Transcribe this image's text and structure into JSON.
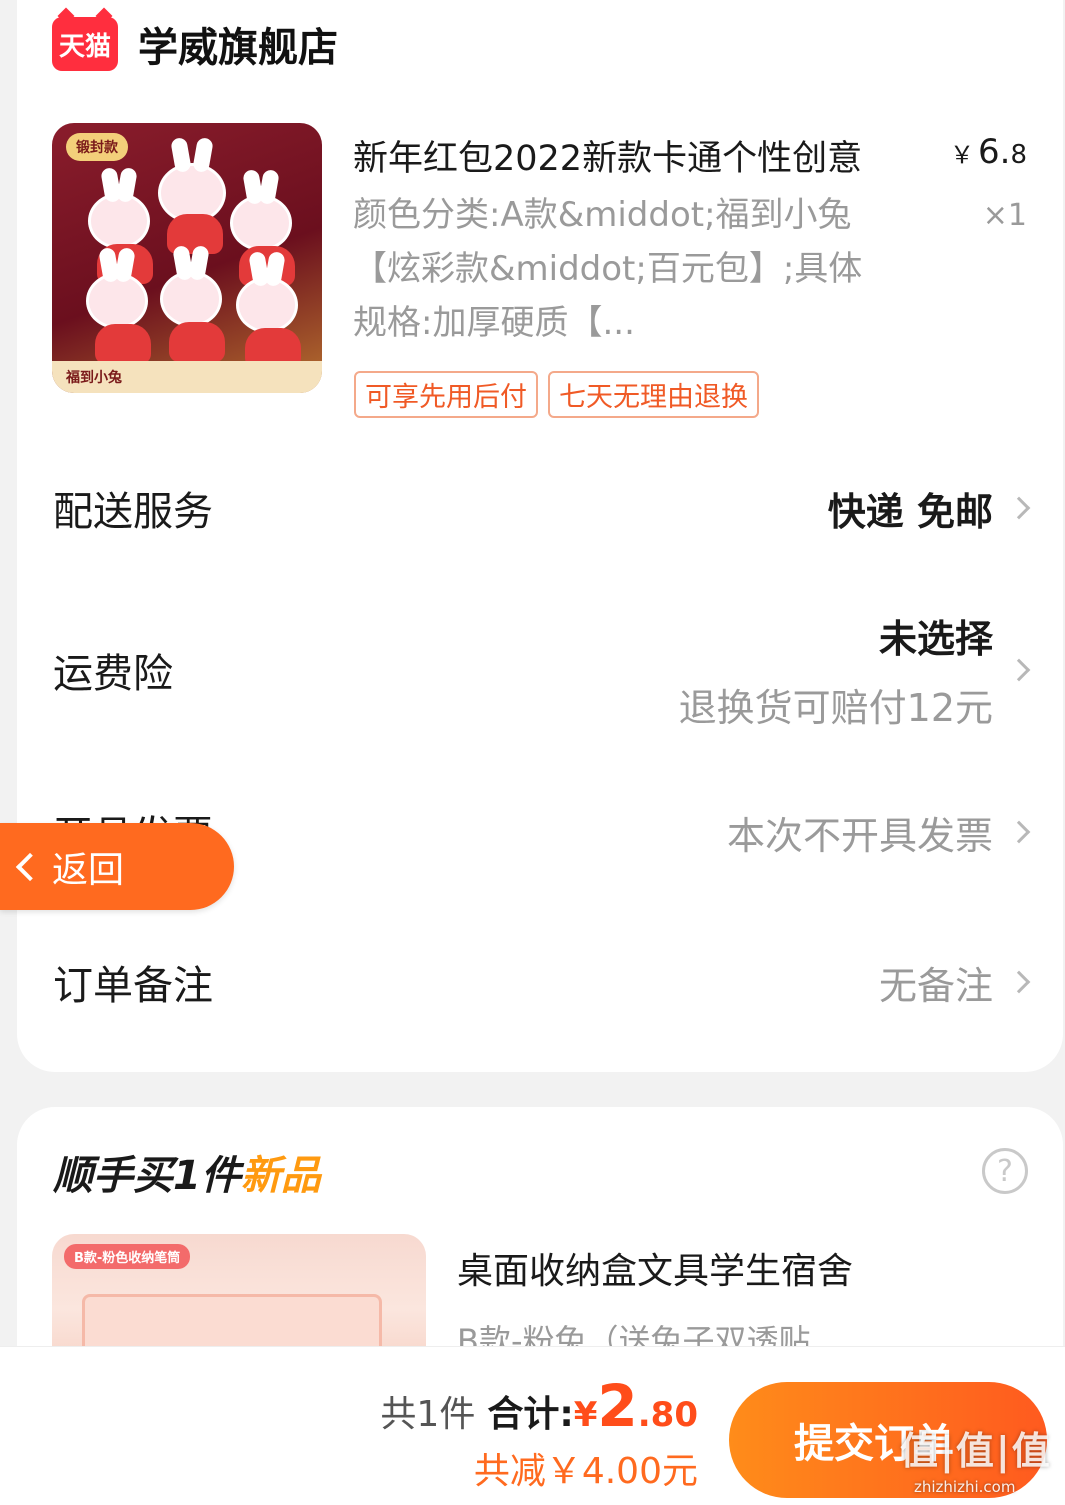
{
  "store": {
    "logo_text": "天猫",
    "name": "学威旗舰店"
  },
  "product": {
    "title": "新年红包2022新款卡通个性创意",
    "price_currency": "￥",
    "price_int": "6.",
    "price_dec": "8",
    "sku": "颜色分类:A款&middot;福到小兔【炫彩款&middot;百元包】;具体规格:加厚硬质【...",
    "quantity": "×1",
    "thumb_tag": "锻封款",
    "thumb_footer": "福到小兔",
    "tags": [
      "可享先用后付",
      "七天无理由退换"
    ]
  },
  "rows": {
    "delivery": {
      "label": "配送服务",
      "value": "快递 免邮"
    },
    "insurance": {
      "label": "运费险",
      "value": "未选择",
      "sub": "退换货可赔付12元"
    },
    "invoice": {
      "label": "开具发票",
      "value": "本次不开具发票"
    },
    "remark": {
      "label": "订单备注",
      "value": "无备注"
    }
  },
  "back_button": {
    "label": "返回"
  },
  "upsell": {
    "title_prefix": "顺手买1件",
    "title_highlight": "新品",
    "help_symbol": "?",
    "item_name": "桌面收纳盒文具学生宿舍",
    "item_sku": "B款-粉兔（送兔子双透贴",
    "thumb_tag": "B款-粉色收纳笔筒"
  },
  "footer": {
    "count": "共1件",
    "total_label": "合计:",
    "total_currency": "¥",
    "total_int": "2",
    "total_dec": ".80",
    "discount": "共减￥4.00元",
    "submit_label": "提交订单"
  },
  "watermark": {
    "text": "值|值|值",
    "url": "zhizhizhi.com"
  },
  "colors": {
    "accent": "#ff6a1f",
    "tmall_red": "#ff2e3e",
    "muted": "#9a9a9a"
  }
}
